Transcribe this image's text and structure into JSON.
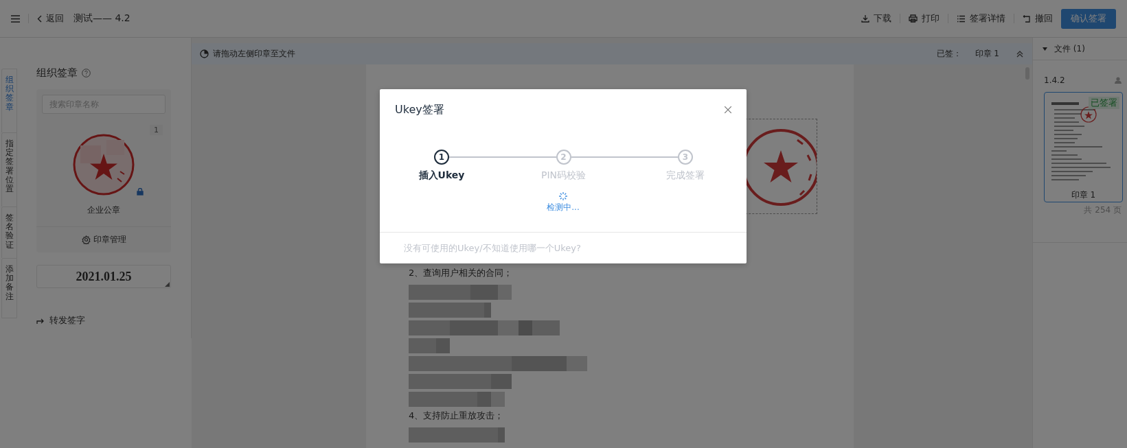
{
  "topbar": {
    "back": "返回",
    "title": "测试—— 4.2",
    "actions": [
      {
        "kind": "download",
        "label": "下载"
      },
      {
        "kind": "print",
        "label": "打印"
      },
      {
        "kind": "details",
        "label": "签署详情"
      },
      {
        "kind": "undo",
        "label": "撤回"
      }
    ],
    "confirm_button": "确认签署"
  },
  "side_tabs": [
    {
      "label": "组织签章",
      "selected": true
    },
    {
      "label": "指定签署位置",
      "selected": false
    },
    {
      "label": "签名验证",
      "selected": false
    },
    {
      "label": "添加备注",
      "selected": false
    }
  ],
  "seal_panel": {
    "title": "组织签章",
    "search": {
      "placeholder": "搜索印章名称"
    },
    "seal": {
      "count": "1",
      "name": "企业公章",
      "locked": true
    },
    "manage": "印章管理",
    "date": "2021.01.25",
    "forward": "转发签字"
  },
  "tip_bar": {
    "hint": "请拖动左侧印章至文件",
    "signed_label": "已签：",
    "signed_value": "印章 1"
  },
  "document": {
    "lines": [
      {
        "kind": "text",
        "text": "2、查询用户相关的合同；"
      },
      {
        "kind": "blur"
      },
      {
        "kind": "blur"
      },
      {
        "kind": "blur"
      },
      {
        "kind": "blur"
      },
      {
        "kind": "blur"
      },
      {
        "kind": "blur"
      },
      {
        "kind": "blur"
      },
      {
        "kind": "text",
        "text": "4、支持防止重放攻击；"
      },
      {
        "kind": "blur"
      }
    ]
  },
  "file_panel": {
    "header": "文件 (1)",
    "file_name": "1.4.2",
    "thumb_badge": "已签署",
    "thumb_caption": "印章 1",
    "pages": "共 254 页"
  },
  "dialog": {
    "title": "Ukey签署",
    "steps": [
      {
        "number": "1",
        "label": "插入Ukey",
        "selected": true
      },
      {
        "number": "2",
        "label": "PIN码校验",
        "selected": false
      },
      {
        "number": "3",
        "label": "完成签署",
        "selected": false
      }
    ],
    "status": "检测中...",
    "footer": "没有可使用的Ukey/不知道使用哪一个Ukey?"
  }
}
